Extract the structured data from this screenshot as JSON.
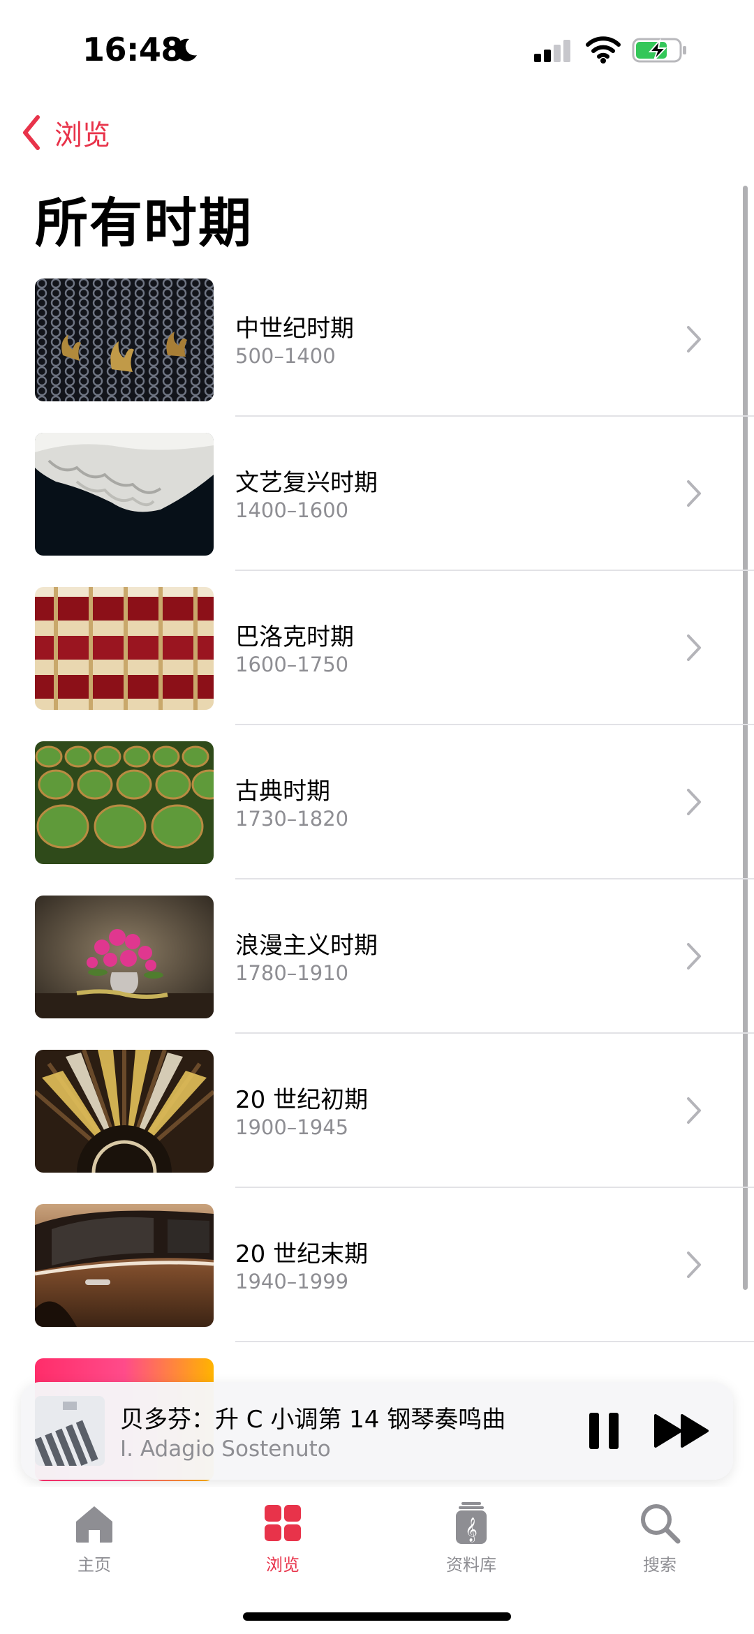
{
  "status_bar": {
    "time": "16:48"
  },
  "nav": {
    "back_label": "浏览"
  },
  "page": {
    "title": "所有时期"
  },
  "periods": [
    {
      "title": "中世纪时期",
      "years": "500–1400",
      "image": "chainmail"
    },
    {
      "title": "文艺复兴时期",
      "years": "1400–1600",
      "image": "lace-ruff"
    },
    {
      "title": "巴洛克时期",
      "years": "1600–1750",
      "image": "opera-boxes"
    },
    {
      "title": "古典时期",
      "years": "1730–1820",
      "image": "green-seats"
    },
    {
      "title": "浪漫主义时期",
      "years": "1780–1910",
      "image": "flower-vase"
    },
    {
      "title": "20 世纪初期",
      "years": "1900–1945",
      "image": "art-deco-fan"
    },
    {
      "title": "20 世纪末期",
      "years": "1940–1999",
      "image": "vintage-car"
    }
  ],
  "mini_player": {
    "title": "贝多芬：升 C 小调第 14 钢琴奏鸣曲",
    "subtitle": "I. Adagio Sostenuto"
  },
  "tabs": [
    {
      "label": "主页",
      "icon": "home-icon"
    },
    {
      "label": "浏览",
      "icon": "browse-grid-icon",
      "active": true
    },
    {
      "label": "资料库",
      "icon": "library-icon"
    },
    {
      "label": "搜索",
      "icon": "search-icon"
    }
  ],
  "colors": {
    "accent": "#e8334a",
    "secondary_text": "#8e8e93"
  }
}
